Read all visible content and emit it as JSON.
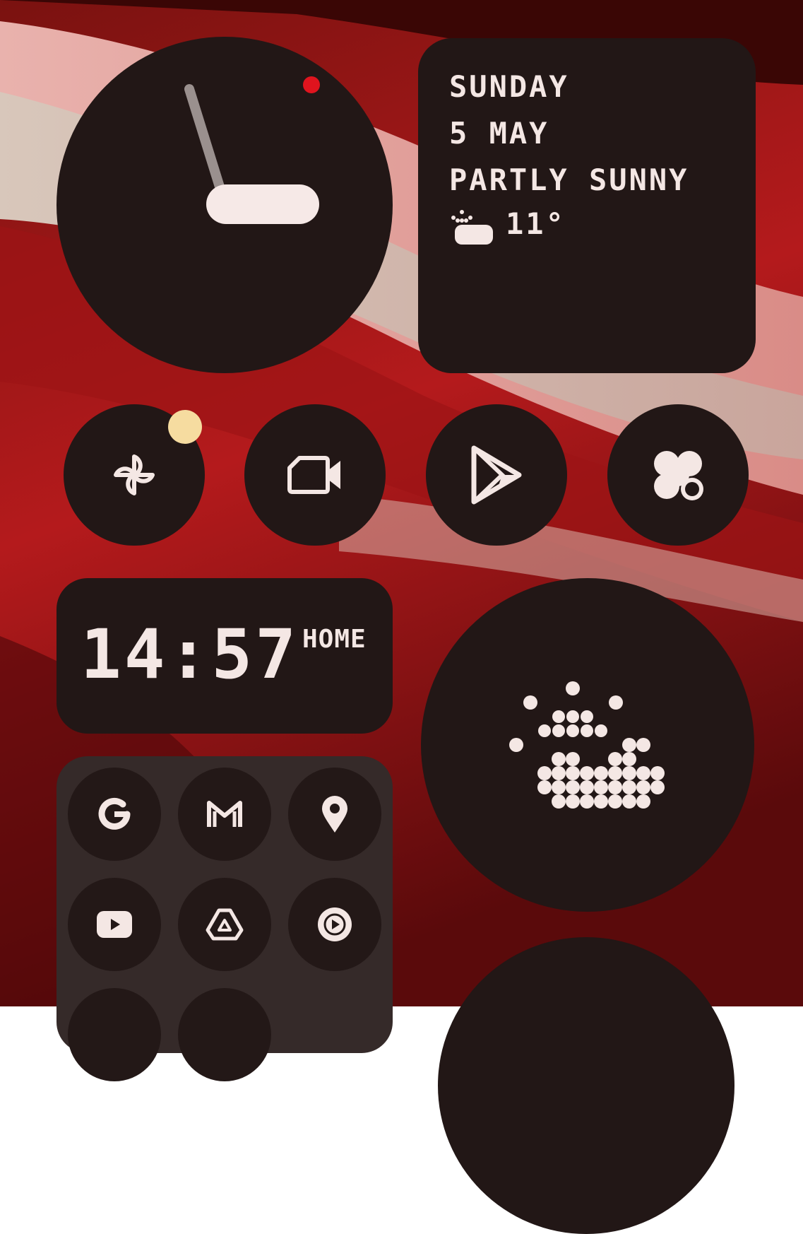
{
  "colors": {
    "widget_bg": "#221716",
    "grid_bg": "#352a29",
    "text": "#f4e7e4",
    "accent_red": "#e0141e",
    "badge_yellow": "#f6dca0",
    "wallpaper_red": "#b0191c",
    "wallpaper_pink": "#e7a9a4"
  },
  "date_widget": {
    "day": "SUNDAY",
    "date": "5 MAY",
    "condition": "PARTLY SUNNY",
    "temperature": "11°",
    "weather_icon": "partly-sunny-icon"
  },
  "clock": {
    "hours": 14,
    "minutes": 57
  },
  "digital_clock": {
    "time": "14:57",
    "label": "HOME"
  },
  "apps_row": [
    {
      "name": "Pinwheel",
      "icon": "pinwheel-icon",
      "badge": true
    },
    {
      "name": "Meet",
      "icon": "video-camera-icon",
      "badge": false
    },
    {
      "name": "Play Store",
      "icon": "play-store-icon",
      "badge": false
    },
    {
      "name": "Nothing X",
      "icon": "nothing-x-icon",
      "badge": false
    }
  ],
  "app_grid": [
    {
      "name": "Google",
      "icon": "google-icon"
    },
    {
      "name": "Gmail",
      "icon": "gmail-icon"
    },
    {
      "name": "Maps",
      "icon": "location-pin-icon"
    },
    {
      "name": "YouTube",
      "icon": "youtube-icon"
    },
    {
      "name": "Drive",
      "icon": "drive-icon"
    },
    {
      "name": "YouTube Music",
      "icon": "youtube-music-icon"
    }
  ]
}
